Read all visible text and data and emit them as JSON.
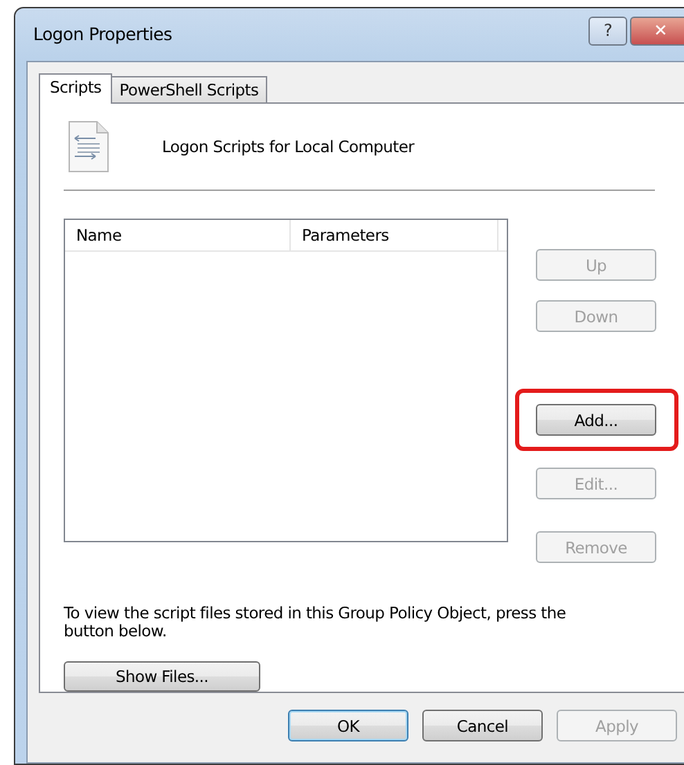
{
  "window": {
    "title": "Logon Properties",
    "title_buttons": [
      {
        "kind": "help",
        "label": "?"
      },
      {
        "kind": "close",
        "label": "✕"
      }
    ]
  },
  "tabs": [
    {
      "label": "Scripts",
      "selected": true
    },
    {
      "label": "PowerShell Scripts",
      "selected": false
    }
  ],
  "header": {
    "title": "Logon Scripts for Local Computer"
  },
  "table": {
    "columns": [
      "Name",
      "Parameters"
    ]
  },
  "side_buttons": [
    {
      "label": "Up",
      "disabled": true,
      "highlighted": false
    },
    {
      "label": "Down",
      "disabled": true,
      "highlighted": false
    },
    {
      "label": "Add...",
      "disabled": false,
      "highlighted": true
    },
    {
      "label": "Edit...",
      "disabled": true,
      "highlighted": false
    },
    {
      "label": "Remove",
      "disabled": true,
      "highlighted": false
    }
  ],
  "info_text": "To view the script files stored in this Group Policy Object, press the button below.",
  "show_files_button": {
    "label": "Show Files..."
  },
  "footer_buttons": [
    {
      "label": "OK",
      "default": true,
      "disabled": false
    },
    {
      "label": "Cancel",
      "default": false,
      "disabled": false
    },
    {
      "label": "Apply",
      "default": false,
      "disabled": true
    }
  ]
}
